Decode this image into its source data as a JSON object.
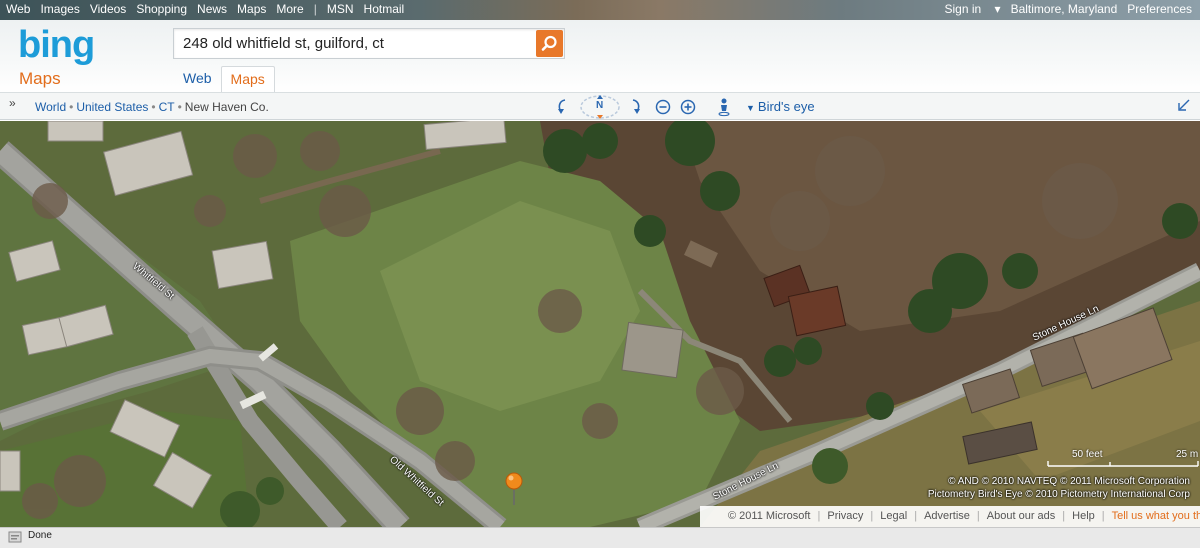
{
  "topnav": {
    "links": [
      "Web",
      "Images",
      "Videos",
      "Shopping",
      "News",
      "Maps",
      "More"
    ],
    "extra_links": [
      "MSN",
      "Hotmail"
    ],
    "sign_in": "Sign in",
    "location": "Baltimore, Maryland",
    "preferences": "Preferences"
  },
  "header": {
    "logo": "bing",
    "section": "Maps",
    "search_value": "248 old whitfield st, guilford, ct",
    "tabs": [
      {
        "label": "Web",
        "active": false
      },
      {
        "label": "Maps",
        "active": true
      }
    ]
  },
  "toolbar": {
    "expand": "»",
    "breadcrumb": [
      "World",
      "United States",
      "CT",
      "New Haven Co."
    ],
    "compass": "N",
    "view": "Bird's eye"
  },
  "map": {
    "road_labels": [
      "Whitfield St",
      "Old Whitfield St",
      "Stone House Ln",
      "Stone House Ln"
    ],
    "scale_feet": "50 feet",
    "scale_m": "25 m",
    "copyright_1": "© AND  © 2010 NAVTEQ  © 2011 Microsoft Corporation",
    "copyright_2": "Pictometry Bird's Eye © 2010 Pictometry International Corp",
    "pin_color": "#f08a1c"
  },
  "footer": {
    "items": [
      "© 2011 Microsoft",
      "Privacy",
      "Legal",
      "Advertise",
      "About our ads",
      "Help"
    ],
    "feedback": "Tell us what you think"
  },
  "status": {
    "text": "Done"
  },
  "colors": {
    "bing_blue": "#1d9cd8",
    "accent_orange": "#e26d1b",
    "link_blue": "#1c5ea8"
  }
}
